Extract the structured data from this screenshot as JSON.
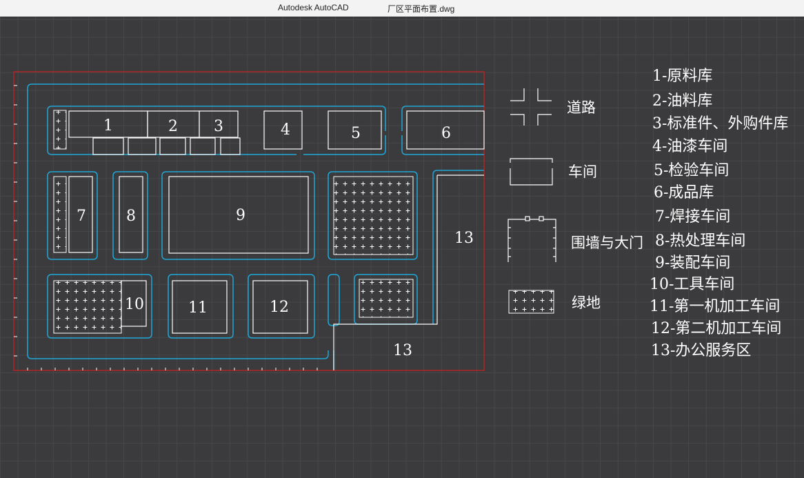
{
  "window": {
    "app_title": "Autodesk AutoCAD",
    "file_title": "厂区平面布置.dwg"
  },
  "buildings": {
    "b1": "1",
    "b2": "2",
    "b3": "3",
    "b4": "4",
    "b5": "5",
    "b6": "6",
    "b7": "7",
    "b8": "8",
    "b9": "9",
    "b10": "10",
    "b11": "11",
    "b12": "12",
    "b13a": "13",
    "b13b": "13"
  },
  "legend_symbols": {
    "road": "道路",
    "workshop": "车间",
    "wall_gate": "围墙与大门",
    "green": "绿地"
  },
  "legend_list": [
    "1-原料库",
    "2-油料库",
    "3-标准件、外购件库",
    "4-油漆车间",
    "5-检验车间",
    "6-成品库",
    "7-焊接车间",
    "8-热处理车间",
    "9-装配车间",
    "10-工具车间",
    "11-第一机加工车间",
    "12-第二机加工车间",
    "13-办公服务区"
  ],
  "colors": {
    "boundary": "#cc1f1f",
    "road": "#1fa7d6",
    "building": "#ffffff",
    "background": "#3b3b3d"
  }
}
